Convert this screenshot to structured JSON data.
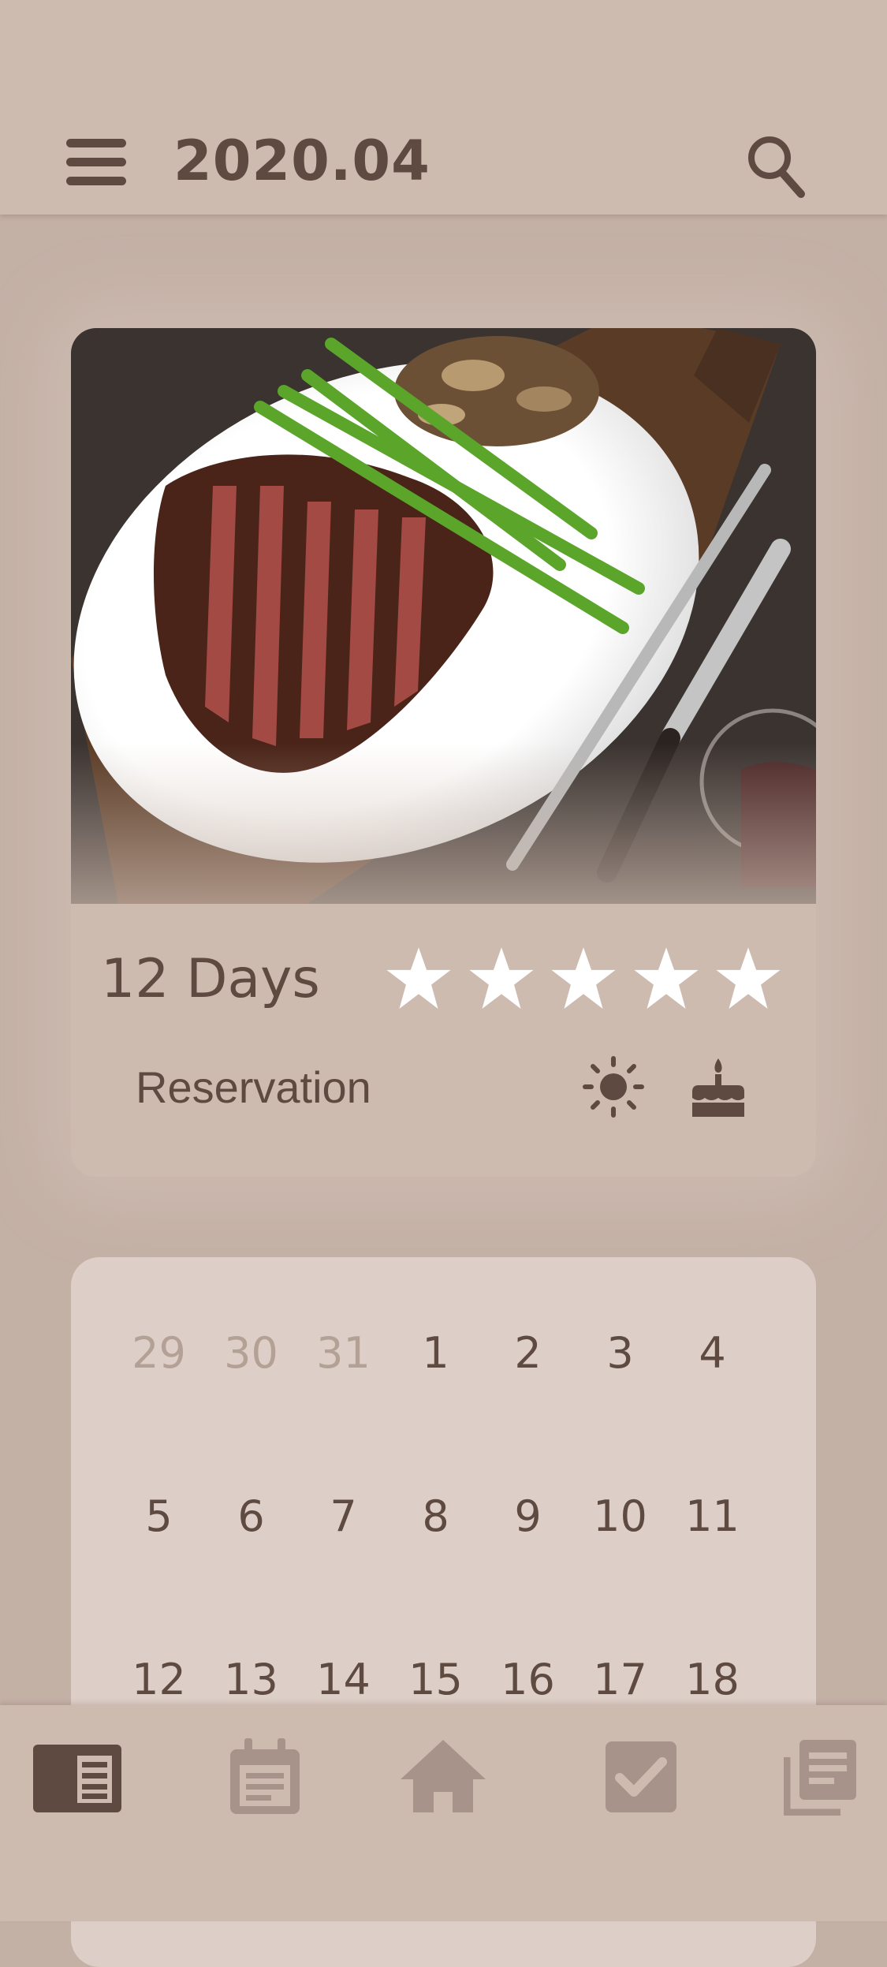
{
  "header": {
    "title": "2020.04",
    "menu_icon": "hamburger-menu-icon",
    "search_icon": "search-icon"
  },
  "feature_card": {
    "image": "steak-asparagus-mushrooms-photo",
    "days_label": "12 Days",
    "rating": {
      "value": 5,
      "max": 5
    },
    "reservation_label": "Reservation",
    "icons": [
      "sun-icon",
      "cake-icon"
    ]
  },
  "calendar": {
    "rows": [
      [
        {
          "day": "29",
          "muted": true
        },
        {
          "day": "30",
          "muted": true
        },
        {
          "day": "31",
          "muted": true
        },
        {
          "day": "1"
        },
        {
          "day": "2"
        },
        {
          "day": "3"
        },
        {
          "day": "4"
        }
      ],
      [
        {
          "day": "5"
        },
        {
          "day": "6"
        },
        {
          "day": "7"
        },
        {
          "day": "8"
        },
        {
          "day": "9"
        },
        {
          "day": "10"
        },
        {
          "day": "11"
        }
      ],
      [
        {
          "day": "12"
        },
        {
          "day": "13"
        },
        {
          "day": "14"
        },
        {
          "day": "15"
        },
        {
          "day": "16"
        },
        {
          "day": "17"
        },
        {
          "day": "18"
        }
      ]
    ]
  },
  "tabbar": {
    "tabs": [
      {
        "icon": "journal-icon",
        "active": true
      },
      {
        "icon": "calendar-icon",
        "active": false
      },
      {
        "icon": "home-icon",
        "active": false
      },
      {
        "icon": "checkbox-icon",
        "active": false
      },
      {
        "icon": "library-icon",
        "active": false
      }
    ]
  },
  "colors": {
    "background": "#c4b1a6",
    "header": "#cebbaf",
    "text": "#5e4a40",
    "calendar_bg": "#ddcfc7",
    "muted": "#b4a196",
    "tab_inactive": "#a8938a"
  }
}
